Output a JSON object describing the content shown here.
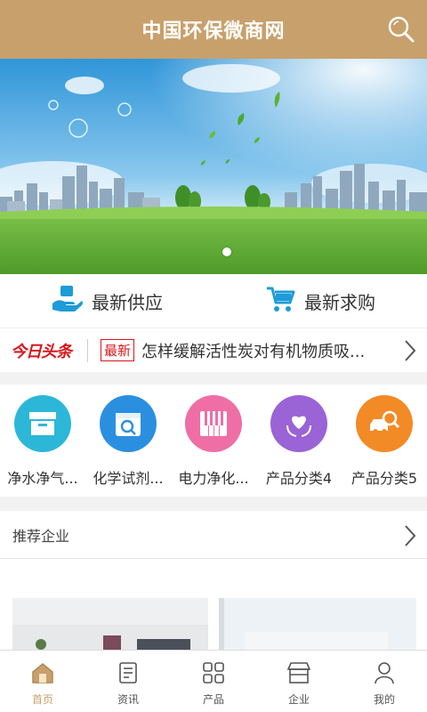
{
  "header": {
    "title": "中国环保微商网",
    "search_icon": "search-icon"
  },
  "banner": {
    "description_icon": "city-park-banner",
    "page_index": 1
  },
  "quick": [
    {
      "label": "最新供应",
      "icon": "hand-box-icon",
      "color": "#1e9bd8"
    },
    {
      "label": "最新求购",
      "icon": "cart-icon",
      "color": "#1e9bd8"
    }
  ],
  "news": {
    "logo": "今日头条",
    "badge": "最新",
    "headline": "怎样缓解活性炭对有机物质吸..."
  },
  "categories": [
    {
      "label": "净水净气...",
      "color": "#2cb7d8",
      "icon": "box-icon"
    },
    {
      "label": "化学试剂...",
      "color": "#2b8fe0",
      "icon": "calendar-search-icon"
    },
    {
      "label": "电力净化...",
      "color": "#ef6ea6",
      "icon": "piano-icon"
    },
    {
      "label": "产品分类4",
      "color": "#9a63d6",
      "icon": "heart-hands-icon"
    },
    {
      "label": "产品分类5",
      "color": "#f28a26",
      "icon": "car-search-icon"
    }
  ],
  "recommend": {
    "title": "推荐企业"
  },
  "tabs": [
    {
      "label": "首页",
      "icon": "home-icon",
      "active": true
    },
    {
      "label": "资讯",
      "icon": "document-icon",
      "active": false
    },
    {
      "label": "产品",
      "icon": "grid-icon",
      "active": false
    },
    {
      "label": "企业",
      "icon": "store-icon",
      "active": false
    },
    {
      "label": "我的",
      "icon": "user-icon",
      "active": false
    }
  ],
  "colors": {
    "header_bg": "#c8a06b",
    "accent": "#c8a06b",
    "news_red": "#d9161c"
  }
}
